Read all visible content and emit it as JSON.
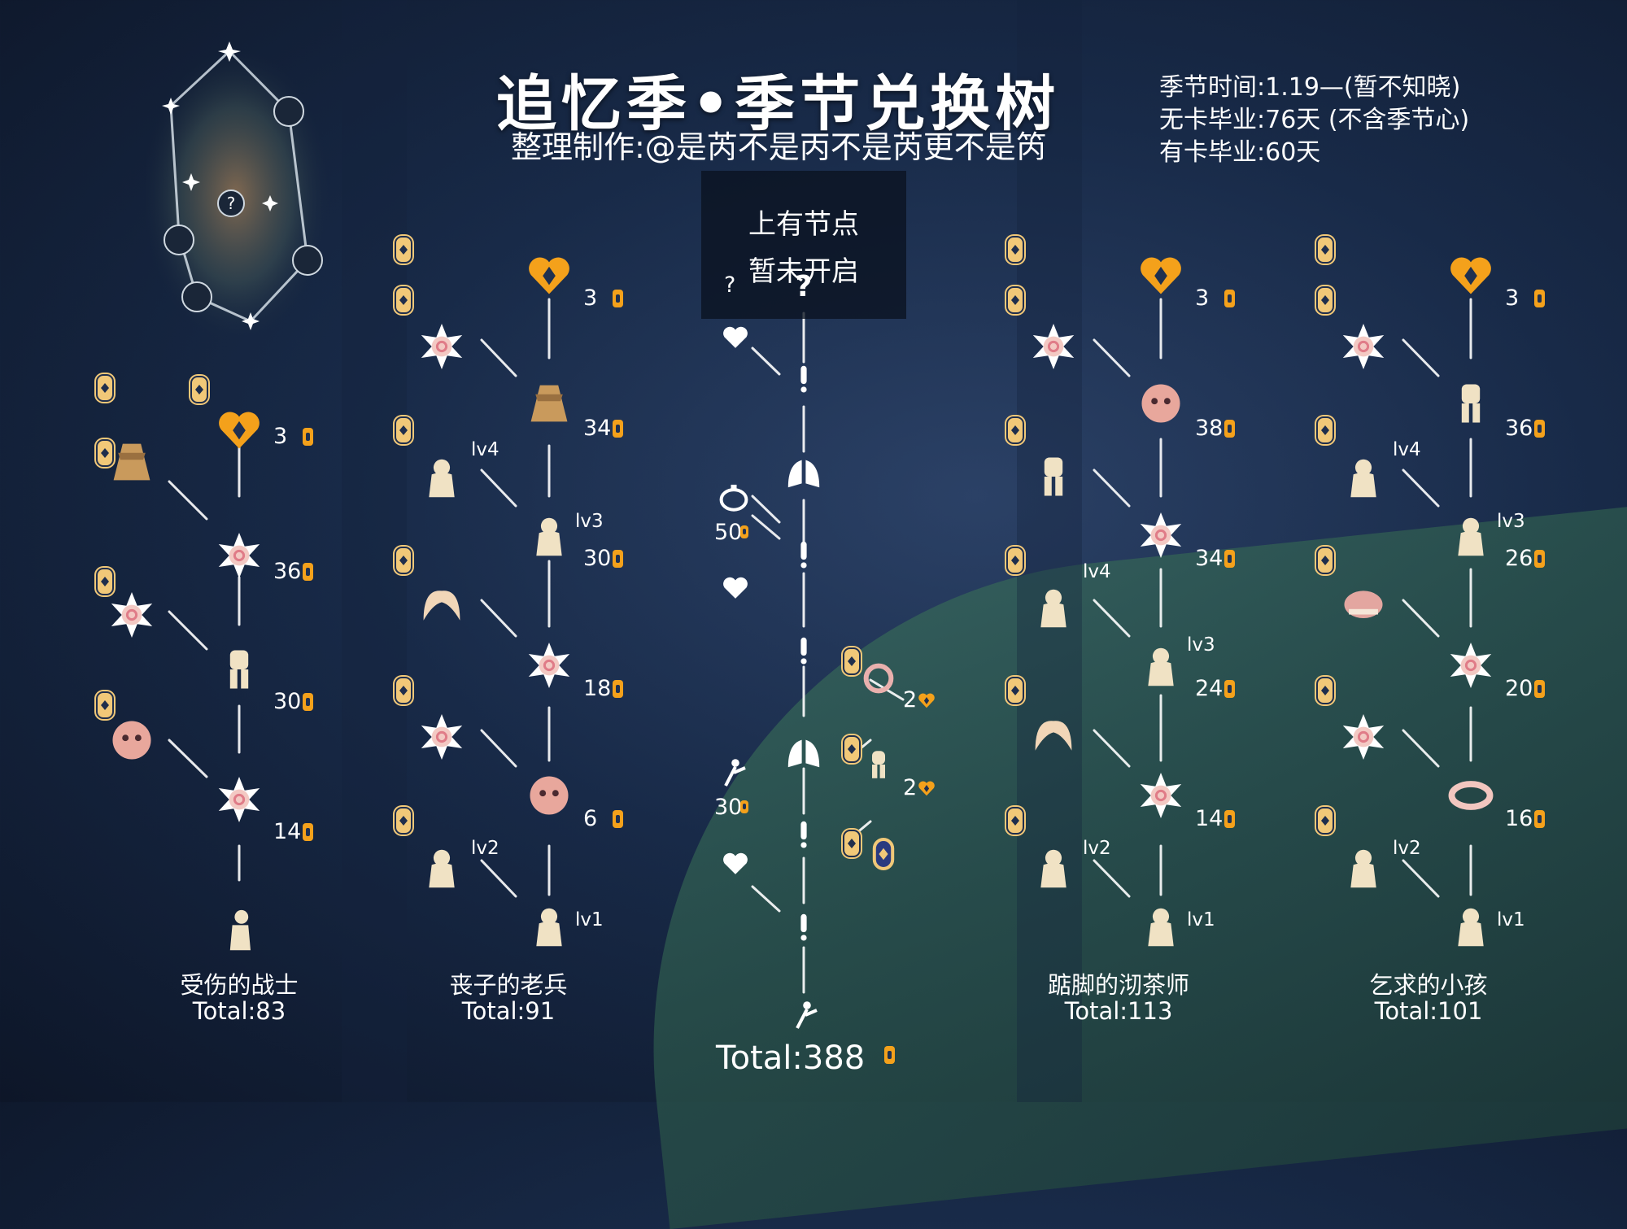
{
  "header": {
    "title": "追忆季•季节兑换树",
    "credit": "整理制作:@是芮不是丙不是芮更不是笍"
  },
  "season_info": [
    "季节时间:1.19—(暂不知晓)",
    "无卡毕业:76天 (不含季节心)",
    "有卡毕业:60天"
  ],
  "locked_notice": {
    "line1": "上有节点",
    "line2": "暂未开启"
  },
  "colors": {
    "candle": "#f4a11b",
    "heart": "#f4a11b",
    "star_body": "#f3c9c3",
    "item": "#f0e2c4"
  },
  "trees": [
    {
      "name": "受伤的战士",
      "total": "Total:83",
      "costs": [
        "3",
        "36",
        "30",
        "14"
      ],
      "levels": [],
      "icons": [
        "season-heart-icon",
        "cape-icon",
        "spell-star-icon",
        "spell-star-icon",
        "outfit-icon",
        "spell-star-icon",
        "mask-icon",
        "kneeling-spirit-icon"
      ]
    },
    {
      "name": "丧子的老兵",
      "total": "Total:91",
      "costs": [
        "3",
        "34",
        "30",
        "18",
        "6"
      ],
      "levels": [
        "lv4",
        "lv3",
        "lv2",
        "lv1"
      ],
      "icons": [
        "season-heart-icon",
        "spell-star-icon",
        "cape-icon",
        "emote-icon",
        "emote-icon",
        "hair-icon",
        "spell-star-icon",
        "spell-star-icon",
        "mask-icon",
        "emote-icon",
        "emote-icon"
      ]
    },
    {
      "name": "踮脚的沏茶师",
      "total": "Total:113",
      "costs": [
        "3",
        "38",
        "34",
        "24",
        "14"
      ],
      "levels": [
        "lv4",
        "lv3",
        "lv2",
        "lv1"
      ],
      "icons": [
        "season-heart-icon",
        "spell-star-icon",
        "mask-icon",
        "outfit-icon",
        "spell-star-icon",
        "emote-icon",
        "emote-icon",
        "hair-icon",
        "spell-star-icon",
        "emote-icon",
        "emote-icon"
      ]
    },
    {
      "name": "乞求的小孩",
      "total": "Total:101",
      "costs": [
        "3",
        "36",
        "26",
        "20",
        "16"
      ],
      "levels": [
        "lv4",
        "lv3",
        "lv2",
        "lv1"
      ],
      "icons": [
        "season-heart-icon",
        "spell-star-icon",
        "outfit-icon",
        "emote-icon",
        "emote-icon",
        "hat-icon",
        "spell-star-icon",
        "spell-star-icon",
        "accessory-icon",
        "emote-icon",
        "emote-icon"
      ]
    }
  ],
  "guide_tree": {
    "locked_costs": [
      "?"
    ],
    "item_costs": [
      "50",
      "30"
    ],
    "heart_costs": [
      "2",
      "2"
    ],
    "total": "Total:388"
  }
}
